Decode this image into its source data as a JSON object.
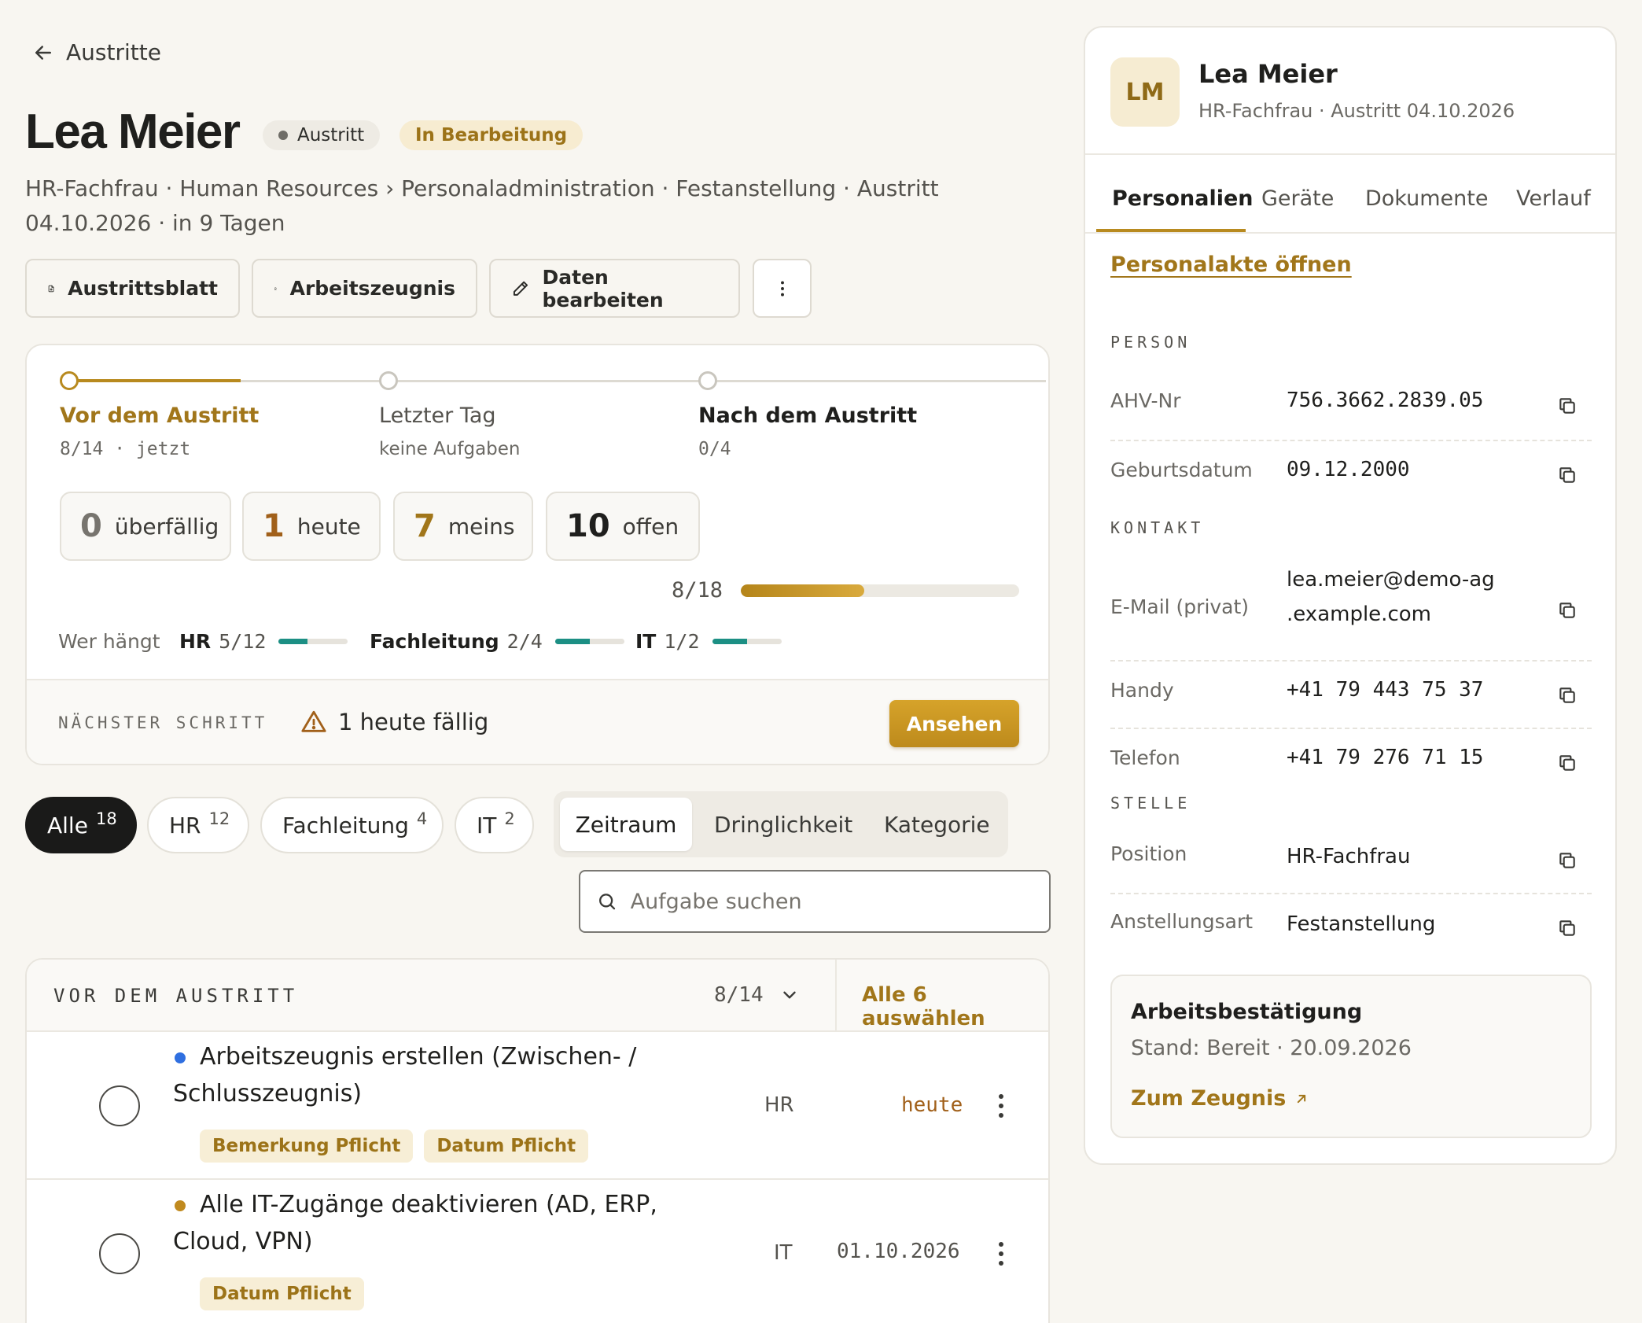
{
  "nav": {
    "back_label": "Austritte"
  },
  "employee": {
    "name": "Lea Meier",
    "badge_type": "Austritt",
    "badge_status": "In Bearbeitung",
    "subline": "HR-Fachfrau · Human Resources › Personaladministration · Festanstellung · Austritt 04.10.2026 · in 9 Tagen"
  },
  "actions": {
    "austrittsblatt": "Austrittsblatt",
    "arbeitszeugnis": "Arbeitszeugnis",
    "daten_bearbeiten": "Daten bearbeiten"
  },
  "phases": [
    {
      "title": "Vor dem Austritt",
      "sub": "8/14 · jetzt"
    },
    {
      "title": "Letzter Tag",
      "sub": "keine Aufgaben"
    },
    {
      "title": "Nach dem Austritt",
      "sub": "0/4"
    }
  ],
  "stats": [
    {
      "value": "0",
      "label": "überfällig"
    },
    {
      "value": "1",
      "label": "heute"
    },
    {
      "value": "7",
      "label": "meins"
    },
    {
      "value": "10",
      "label": "offen"
    }
  ],
  "overall": {
    "label": "8/18",
    "done": 8,
    "total": 18
  },
  "owners": {
    "label": "Wer hängt",
    "items": [
      {
        "name": "HR",
        "count": "5/12",
        "fraction": 0.4167
      },
      {
        "name": "Fachleitung",
        "count": "2/4",
        "fraction": 0.5
      },
      {
        "name": "IT",
        "count": "1/2",
        "fraction": 0.5
      }
    ]
  },
  "next_step": {
    "label": "NÄCHSTER SCHRITT",
    "text": "1 heute fällig",
    "button": "Ansehen"
  },
  "filters": {
    "pills": [
      {
        "label": "Alle",
        "count": "18"
      },
      {
        "label": "HR",
        "count": "12"
      },
      {
        "label": "Fachleitung",
        "count": "4"
      },
      {
        "label": "IT",
        "count": "2"
      }
    ],
    "segments": [
      "Zeitraum",
      "Dringlichkeit",
      "Kategorie"
    ],
    "search_placeholder": "Aufgabe suchen"
  },
  "task_group": {
    "title": "VOR DEM AUSTRITT",
    "count": "8/14",
    "select_all": "Alle 6 auswählen"
  },
  "tasks": [
    {
      "title": "Arbeitszeugnis erstellen (Zwischen- / Schlusszeugnis)",
      "owner": "HR",
      "due": "heute",
      "tags": [
        "Bemerkung Pflicht",
        "Datum Pflicht"
      ],
      "dot_color": "#2f6fe0"
    },
    {
      "title": "Alle IT-Zugänge deaktivieren (AD, ERP, Cloud, VPN)",
      "owner": "IT",
      "due": "01.10.2026",
      "tags": [
        "Datum Pflicht"
      ],
      "dot_color": "#c08a1f"
    }
  ],
  "panel": {
    "initials": "LM",
    "name": "Lea Meier",
    "sub": "HR-Fachfrau · Austritt 04.10.2026",
    "tabs": [
      "Personalien",
      "Geräte",
      "Dokumente",
      "Verlauf"
    ],
    "akte_link": "Personalakte öffnen",
    "sections": {
      "person": "PERSON",
      "kontakt": "KONTAKT",
      "stelle": "STELLE"
    },
    "fields": {
      "ahv": {
        "label": "AHV-Nr",
        "value": "756.3662.2839.05"
      },
      "geburt": {
        "label": "Geburtsdatum",
        "value": "09.12.2000"
      },
      "email": {
        "label": "E-Mail (privat)",
        "value": "lea.meier@demo-ag .example.com"
      },
      "handy": {
        "label": "Handy",
        "value": "+41 79 443 75 37"
      },
      "telefon": {
        "label": "Telefon",
        "value": "+41 79 276 71 15"
      },
      "position": {
        "label": "Position",
        "value": "HR-Fachfrau"
      },
      "anstellung": {
        "label": "Anstellungsart",
        "value": "Festanstellung"
      }
    },
    "confirmation": {
      "title": "Arbeitsbestätigung",
      "sub": "Stand: Bereit · 20.09.2026",
      "link": "Zum Zeugnis"
    }
  }
}
